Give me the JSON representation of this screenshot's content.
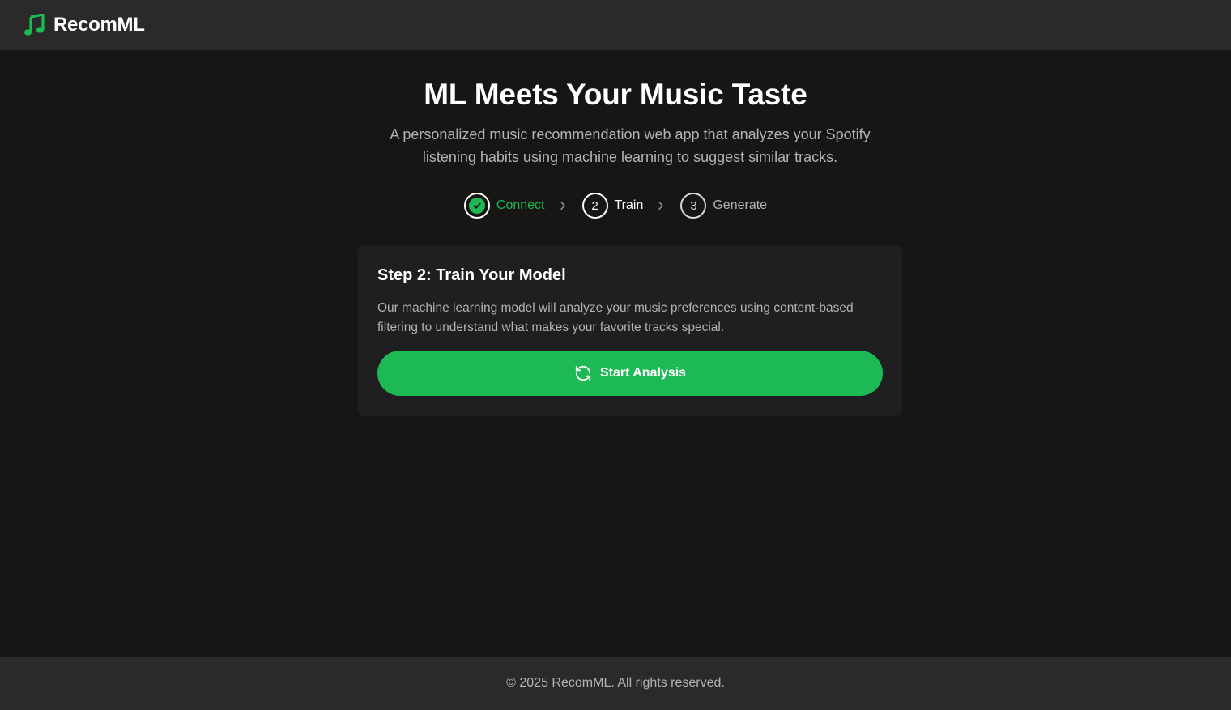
{
  "app": {
    "brand": "RecomML",
    "logo_icon": "music-note-icon",
    "accent_color": "#1db954"
  },
  "hero": {
    "title": "ML Meets Your Music Taste",
    "subtitle": "A personalized music recommendation web app that analyzes your Spotify listening habits using machine learning to suggest similar tracks."
  },
  "steps": [
    {
      "number": "1",
      "label": "Connect",
      "status": "completed",
      "icon": "check-icon"
    },
    {
      "number": "2",
      "label": "Train",
      "status": "active"
    },
    {
      "number": "3",
      "label": "Generate",
      "status": "pending"
    }
  ],
  "card": {
    "title": "Step 2: Train Your Model",
    "description": "Our machine learning model will analyze your music preferences using content-based filtering to understand what makes your favorite tracks special.",
    "button_label": "Start Analysis",
    "button_icon": "refresh-icon"
  },
  "footer": {
    "text": "© 2025 RecomML. All rights reserved."
  }
}
